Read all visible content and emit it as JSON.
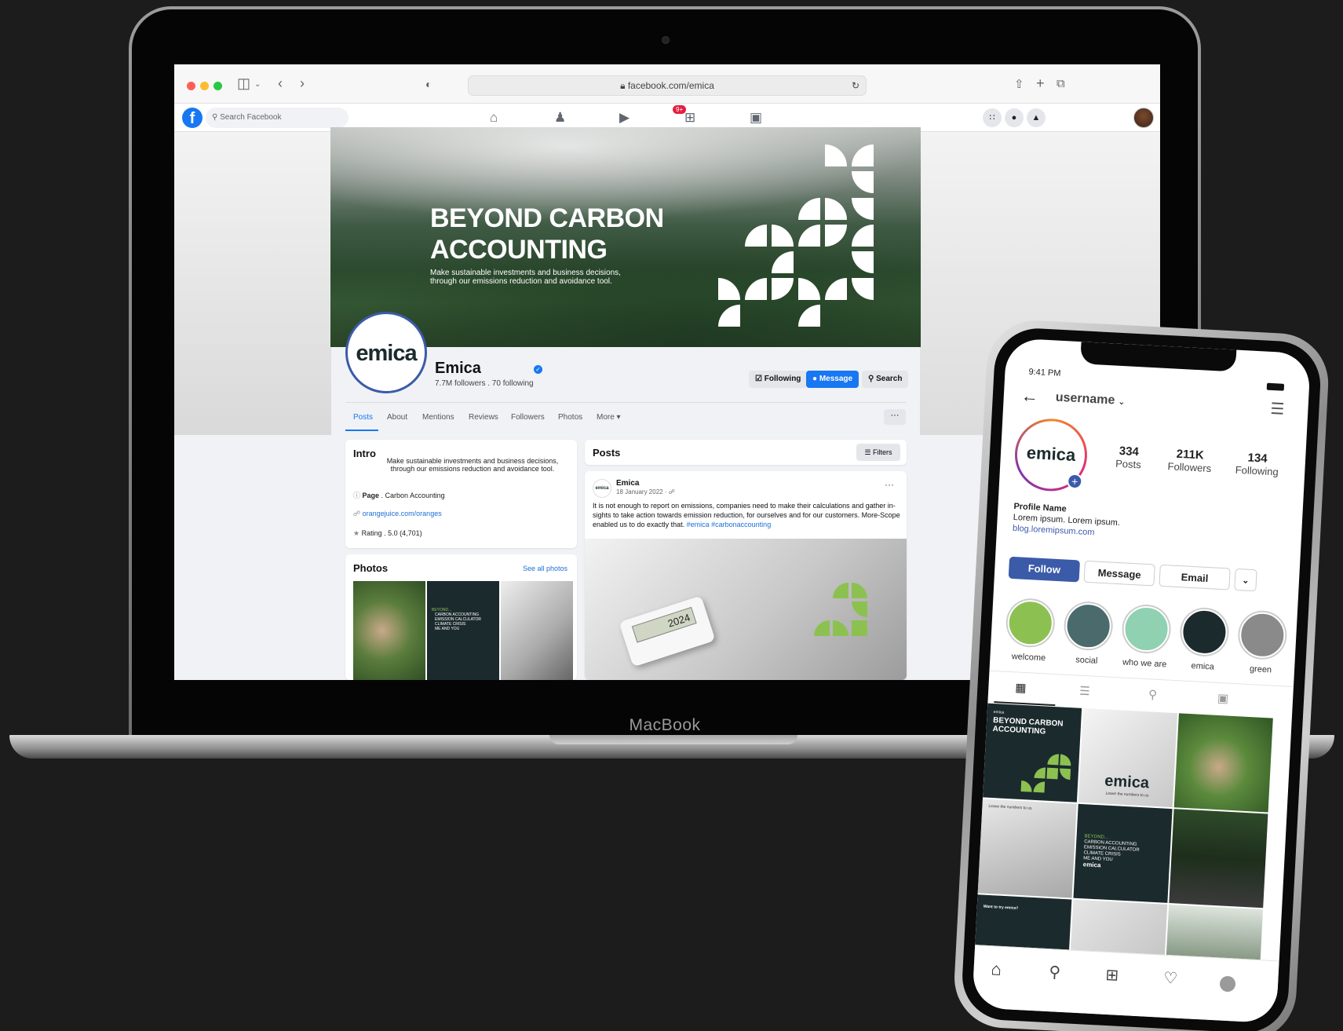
{
  "browser": {
    "url": "facebook.com/emica"
  },
  "facebook": {
    "search_placeholder": "Search Facebook",
    "nav_badge": "9+",
    "cover": {
      "headline_line1": "BEYOND CARBON",
      "headline_line2": "ACCOUNTING",
      "subline": "Make sustainable investments and business decisions, through our emissions reduction and avoidance tool."
    },
    "page": {
      "logo_text": "emica",
      "name": "Emica",
      "stats": "7.7M followers . 70 following",
      "buttons": {
        "following": "Following",
        "message": "Message",
        "search": "Search"
      },
      "tabs": [
        "Posts",
        "About",
        "Mentions",
        "Reviews",
        "Followers",
        "Photos",
        "More ▾"
      ],
      "more_dots": "···"
    },
    "intro": {
      "title": "Intro",
      "text": "Make sustainable investments and business decisions, through our emissions reduction and avoidance tool.",
      "page_label": "Page",
      "page_value": " . Carbon Accounting",
      "website": "orangejuice.com/oranges",
      "rating": "Rating . 5.0 (4,701)"
    },
    "photos": {
      "title": "Photos",
      "see_all": "See all photos",
      "tile_heading": "BEYOND...",
      "tile_items": [
        "CARBON ACCOUNTING",
        "EMISSION CALCULATOR",
        "CLIMATE CRISIS",
        "ME AND YOU"
      ]
    },
    "posts": {
      "title": "Posts",
      "filters": "Filters",
      "post_logo": "emica",
      "author": "Emica",
      "date": "18 January 2022 ·",
      "body": "It is not enough to report on emissions, companies need to make their calculations and gather in-sights to take action towards emission reduction, for ourselves and for our customers. More-Scope enabled us to do exactly that.",
      "tag1": "#emica",
      "tag2": "#carbonaccounting",
      "calculator_display": "2024",
      "post_menu": "···"
    }
  },
  "laptop": {
    "brand": "MacBook"
  },
  "instagram": {
    "time": "9:41 PM",
    "username": "username",
    "logo_text": "emica",
    "stats": [
      {
        "value": "334",
        "label": "Posts"
      },
      {
        "value": "211K",
        "label": "Followers"
      },
      {
        "value": "134",
        "label": "Following"
      }
    ],
    "profile_name": "Profile Name",
    "bio": "Lorem ipsum. Lorem ipsum.",
    "link": "blog.loremipsum.com",
    "buttons": {
      "follow": "Follow",
      "message": "Message",
      "email": "Email"
    },
    "highlights": [
      {
        "label": "welcome",
        "color": "#8cc152"
      },
      {
        "label": "social",
        "color": "#4a6a6c"
      },
      {
        "label": "who we are",
        "color": "#8fd1b0"
      },
      {
        "label": "emica",
        "color": "#1b2a2d"
      },
      {
        "label": "green",
        "color": "#8a8a8a"
      }
    ],
    "tiles": {
      "t1_small": "emica",
      "t1_title": "BEYOND CARBON ACCOUNTING",
      "t2_logo": "emica",
      "t2_sub": "Leave the numbers to us",
      "t4_small": "Leave the numbers to us",
      "t5_heading": "BEYOND...",
      "t5_items": [
        "CARBON ACCOUNTING",
        "EMISSION CALCULATOR",
        "CLIMATE CRISIS",
        "ME AND YOU"
      ],
      "t5_logo": "emica",
      "t7_title": "Want to try emica?"
    }
  },
  "colors": {
    "fb_blue": "#1877f2",
    "ig_blue": "#3b5ba9",
    "brand_green": "#8cc152",
    "brand_dark": "#1b2a2d",
    "backdrop": "#1c1c1c"
  }
}
